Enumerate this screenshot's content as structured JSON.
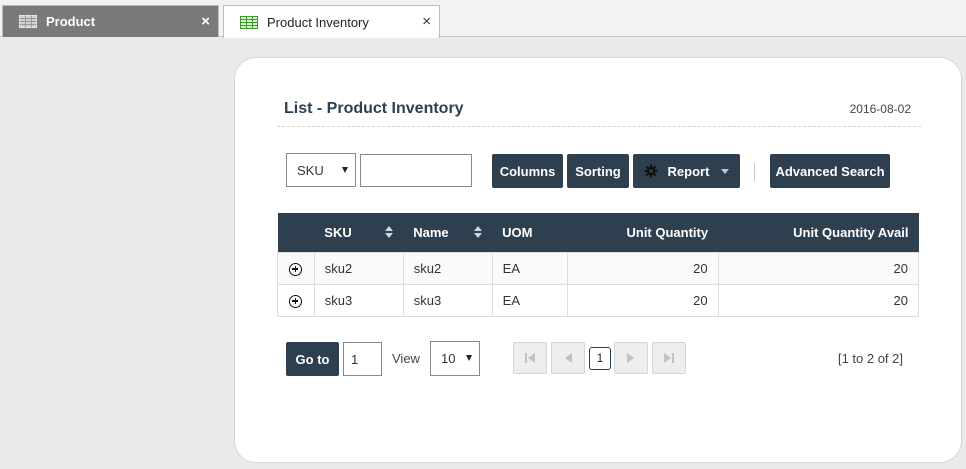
{
  "tabs": [
    {
      "label": "Product",
      "close": "×"
    },
    {
      "label": "Product Inventory",
      "close": "×"
    }
  ],
  "panel": {
    "title": "List - Product Inventory",
    "date": "2016-08-02"
  },
  "toolbar": {
    "search_field": "SKU",
    "search_value": "",
    "columns_label": "Columns",
    "sorting_label": "Sorting",
    "report_label": "Report",
    "advanced_label": "Advanced Search"
  },
  "table": {
    "headers": [
      "SKU",
      "Name",
      "UOM",
      "Unit Quantity",
      "Unit Quantity Avail"
    ],
    "rows": [
      {
        "sku": "sku2",
        "name": "sku2",
        "uom": "EA",
        "qty": "20",
        "avail": "20"
      },
      {
        "sku": "sku3",
        "name": "sku3",
        "uom": "EA",
        "qty": "20",
        "avail": "20"
      }
    ]
  },
  "pager": {
    "goto_label": "Go to",
    "goto_value": "1",
    "view_label": "View",
    "page_size": "10",
    "current_page": "1",
    "range": "[1 to 2 of 2]"
  },
  "colors": {
    "primary": "#2e3f50",
    "tab_inactive": "#7a7a7a",
    "background": "#eaeaea"
  },
  "icons": {
    "tab_icon": "grid-icon",
    "report_icon": "gear-icon",
    "row_expand": "plus-circle-icon"
  }
}
